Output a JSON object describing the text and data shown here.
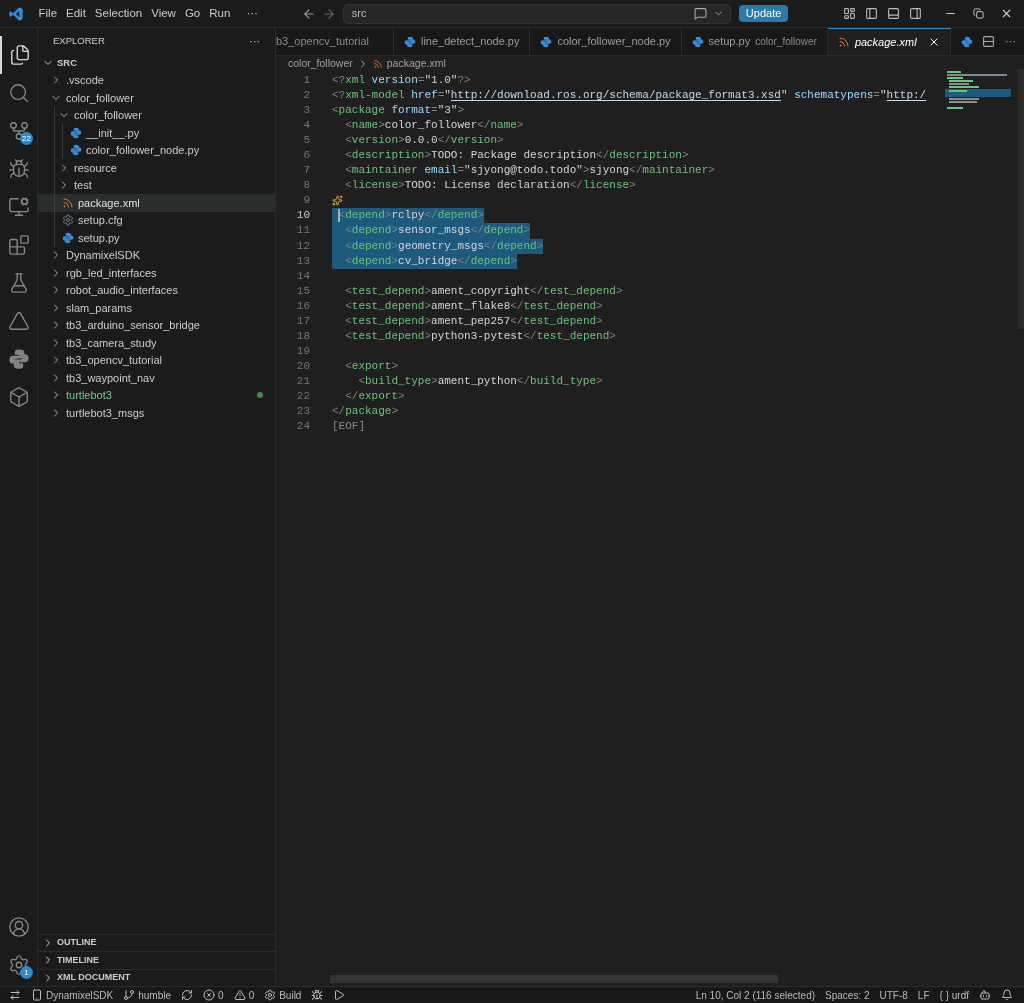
{
  "title_bar": {
    "menus": [
      "File",
      "Edit",
      "Selection",
      "View",
      "Go",
      "Run"
    ],
    "more": "···",
    "search": {
      "value": "src"
    },
    "update_button": "Update"
  },
  "activity_bar": {
    "top": [
      {
        "kind": "files",
        "selected": true
      },
      {
        "kind": "search",
        "selected": false
      },
      {
        "kind": "source-control",
        "selected": false,
        "badge": "22"
      },
      {
        "kind": "run",
        "selected": false
      },
      {
        "kind": "remote",
        "selected": false
      },
      {
        "kind": "extensions",
        "selected": false
      },
      {
        "kind": "testing",
        "selected": false
      },
      {
        "kind": "ros",
        "selected": false
      },
      {
        "kind": "python",
        "selected": false
      },
      {
        "kind": "container",
        "selected": false
      }
    ],
    "bottom": [
      {
        "kind": "account",
        "selected": false
      },
      {
        "kind": "settings",
        "selected": false,
        "badge": "1"
      }
    ]
  },
  "explorer": {
    "title": "EXPLORER",
    "more": "···",
    "root": "SRC",
    "items": [
      {
        "name": ".vscode",
        "kind": "folder",
        "expanded": false,
        "selected": false,
        "changed": false
      },
      {
        "name": "color_follower",
        "kind": "folder",
        "expanded": true,
        "selected": false,
        "changed": false,
        "children": [
          {
            "name": "color_follower",
            "kind": "folder",
            "expanded": true,
            "selected": false,
            "changed": false,
            "children": [
              {
                "name": "__init__.py",
                "kind": "python",
                "selected": false,
                "changed": false
              },
              {
                "name": "color_follower_node.py",
                "kind": "python",
                "selected": false,
                "changed": false
              }
            ]
          },
          {
            "name": "resource",
            "kind": "folder",
            "expanded": false,
            "selected": false,
            "changed": false
          },
          {
            "name": "test",
            "kind": "folder",
            "expanded": false,
            "selected": false,
            "changed": false
          },
          {
            "name": "package.xml",
            "kind": "xml",
            "selected": true,
            "changed": false
          },
          {
            "name": "setup.cfg",
            "kind": "config",
            "selected": false,
            "changed": false
          },
          {
            "name": "setup.py",
            "kind": "python",
            "selected": false,
            "changed": false
          }
        ]
      },
      {
        "name": "DynamixelSDK",
        "kind": "folder",
        "expanded": false,
        "selected": false,
        "changed": false
      },
      {
        "name": "rgb_led_interfaces",
        "kind": "folder",
        "expanded": false,
        "selected": false,
        "changed": false
      },
      {
        "name": "robot_audio_interfaces",
        "kind": "folder",
        "expanded": false,
        "selected": false,
        "changed": false
      },
      {
        "name": "slam_params",
        "kind": "folder",
        "expanded": false,
        "selected": false,
        "changed": false
      },
      {
        "name": "tb3_arduino_sensor_bridge",
        "kind": "folder",
        "expanded": false,
        "selected": false,
        "changed": false
      },
      {
        "name": "tb3_camera_study",
        "kind": "folder",
        "expanded": false,
        "selected": false,
        "changed": false
      },
      {
        "name": "tb3_opencv_tutorial",
        "kind": "folder",
        "expanded": false,
        "selected": false,
        "changed": false
      },
      {
        "name": "tb3_waypoint_nav",
        "kind": "folder",
        "expanded": false,
        "selected": false,
        "changed": false
      },
      {
        "name": "turtlebot3",
        "kind": "folder",
        "expanded": false,
        "selected": false,
        "changed": true
      },
      {
        "name": "turtlebot3_msgs",
        "kind": "folder",
        "expanded": false,
        "selected": false,
        "changed": false
      }
    ],
    "sections": [
      {
        "title": "OUTLINE",
        "expanded": false
      },
      {
        "title": "TIMELINE",
        "expanded": false
      },
      {
        "title": "XML DOCUMENT",
        "expanded": false
      }
    ]
  },
  "tabs": [
    {
      "label": "b3_opencv_tutorial",
      "kind": "none",
      "selected": false
    },
    {
      "label": "line_detect_node.py",
      "kind": "python",
      "selected": false
    },
    {
      "label": "color_follower_node.py",
      "kind": "python",
      "selected": false
    },
    {
      "label": "setup.py",
      "detail": "color_follower",
      "kind": "python",
      "selected": false
    },
    {
      "label": "package.xml",
      "kind": "xml",
      "selected": true
    },
    {
      "kind": "python",
      "selected": false
    }
  ],
  "tab_more": "···",
  "breadcrumb": [
    "color_follower",
    "package.xml"
  ],
  "editor": {
    "lines": [
      {
        "number": "1",
        "selected": false,
        "cursor": false,
        "sparkle": false,
        "tokens": [
          {
            "kind": "punct",
            "text": "<?"
          },
          {
            "kind": "tag",
            "text": "xml"
          },
          {
            "kind": "attr",
            "text": " version"
          },
          {
            "kind": "punct",
            "text": "="
          },
          {
            "kind": "string",
            "text": "\"1.0\""
          },
          {
            "kind": "punct",
            "text": "?>"
          }
        ]
      },
      {
        "number": "2",
        "selected": false,
        "cursor": false,
        "sparkle": false,
        "tokens": [
          {
            "kind": "punct",
            "text": "<?"
          },
          {
            "kind": "tag",
            "text": "xml-model"
          },
          {
            "kind": "attr",
            "text": " href"
          },
          {
            "kind": "punct",
            "text": "="
          },
          {
            "kind": "string",
            "text": "\""
          },
          {
            "kind": "link",
            "text": "http://download.ros.org/schema/package_format3.xsd"
          },
          {
            "kind": "string",
            "text": "\""
          },
          {
            "kind": "attr",
            "text": " schematypens"
          },
          {
            "kind": "punct",
            "text": "="
          },
          {
            "kind": "string",
            "text": "\""
          },
          {
            "kind": "link",
            "text": "http:/"
          }
        ]
      },
      {
        "number": "3",
        "selected": false,
        "cursor": false,
        "sparkle": false,
        "tokens": [
          {
            "kind": "punct",
            "text": "<"
          },
          {
            "kind": "tag",
            "text": "package"
          },
          {
            "kind": "attr",
            "text": " format"
          },
          {
            "kind": "punct",
            "text": "="
          },
          {
            "kind": "string",
            "text": "\"3\""
          },
          {
            "kind": "punct",
            "text": ">"
          }
        ]
      },
      {
        "number": "4",
        "selected": false,
        "cursor": false,
        "sparkle": false,
        "tokens": [
          {
            "kind": "punct",
            "text": "  <"
          },
          {
            "kind": "tag",
            "text": "name"
          },
          {
            "kind": "punct",
            "text": ">"
          },
          {
            "kind": "text",
            "text": "color_follower"
          },
          {
            "kind": "punct",
            "text": "</"
          },
          {
            "kind": "tag",
            "text": "name"
          },
          {
            "kind": "punct",
            "text": ">"
          }
        ]
      },
      {
        "number": "5",
        "selected": false,
        "cursor": false,
        "sparkle": false,
        "tokens": [
          {
            "kind": "punct",
            "text": "  <"
          },
          {
            "kind": "tag",
            "text": "version"
          },
          {
            "kind": "punct",
            "text": ">"
          },
          {
            "kind": "text",
            "text": "0.0.0"
          },
          {
            "kind": "punct",
            "text": "</"
          },
          {
            "kind": "tag",
            "text": "version"
          },
          {
            "kind": "punct",
            "text": ">"
          }
        ]
      },
      {
        "number": "6",
        "selected": false,
        "cursor": false,
        "sparkle": false,
        "tokens": [
          {
            "kind": "punct",
            "text": "  <"
          },
          {
            "kind": "tag",
            "text": "description"
          },
          {
            "kind": "punct",
            "text": ">"
          },
          {
            "kind": "text",
            "text": "TODO: Package description"
          },
          {
            "kind": "punct",
            "text": "</"
          },
          {
            "kind": "tag",
            "text": "description"
          },
          {
            "kind": "punct",
            "text": ">"
          }
        ]
      },
      {
        "number": "7",
        "selected": false,
        "cursor": false,
        "sparkle": false,
        "tokens": [
          {
            "kind": "punct",
            "text": "  <"
          },
          {
            "kind": "tag",
            "text": "maintainer"
          },
          {
            "kind": "attr",
            "text": " email"
          },
          {
            "kind": "punct",
            "text": "="
          },
          {
            "kind": "string",
            "text": "\"sjyong@todo.todo\""
          },
          {
            "kind": "punct",
            "text": ">"
          },
          {
            "kind": "text",
            "text": "sjyong"
          },
          {
            "kind": "punct",
            "text": "</"
          },
          {
            "kind": "tag",
            "text": "maintainer"
          },
          {
            "kind": "punct",
            "text": ">"
          }
        ]
      },
      {
        "number": "8",
        "selected": false,
        "cursor": false,
        "sparkle": false,
        "tokens": [
          {
            "kind": "punct",
            "text": "  <"
          },
          {
            "kind": "tag",
            "text": "license"
          },
          {
            "kind": "punct",
            "text": ">"
          },
          {
            "kind": "text",
            "text": "TODO: License declaration"
          },
          {
            "kind": "punct",
            "text": "</"
          },
          {
            "kind": "tag",
            "text": "license"
          },
          {
            "kind": "punct",
            "text": ">"
          }
        ]
      },
      {
        "number": "9",
        "selected": false,
        "cursor": false,
        "sparkle": true
      },
      {
        "number": "10",
        "selected": true,
        "cursor": true,
        "sparkle": false,
        "tokens": [
          {
            "kind": "punct",
            "text": " <"
          },
          {
            "kind": "tag",
            "text": "depend"
          },
          {
            "kind": "punct",
            "text": ">"
          },
          {
            "kind": "text",
            "text": "rclpy"
          },
          {
            "kind": "punct",
            "text": "</"
          },
          {
            "kind": "tag",
            "text": "depend"
          },
          {
            "kind": "punct",
            "text": ">"
          }
        ]
      },
      {
        "number": "11",
        "selected": true,
        "cursor": false,
        "sparkle": false,
        "tokens": [
          {
            "kind": "punct",
            "text": "  <"
          },
          {
            "kind": "tag",
            "text": "depend"
          },
          {
            "kind": "punct",
            "text": ">"
          },
          {
            "kind": "text",
            "text": "sensor_msgs"
          },
          {
            "kind": "punct",
            "text": "</"
          },
          {
            "kind": "tag",
            "text": "depend"
          },
          {
            "kind": "punct",
            "text": ">"
          }
        ]
      },
      {
        "number": "12",
        "selected": true,
        "cursor": false,
        "sparkle": false,
        "tokens": [
          {
            "kind": "punct",
            "text": "  <"
          },
          {
            "kind": "tag",
            "text": "depend"
          },
          {
            "kind": "punct",
            "text": ">"
          },
          {
            "kind": "text",
            "text": "geometry_msgs"
          },
          {
            "kind": "punct",
            "text": "</"
          },
          {
            "kind": "tag",
            "text": "depend"
          },
          {
            "kind": "punct",
            "text": ">"
          }
        ]
      },
      {
        "number": "13",
        "selected": true,
        "cursor": false,
        "sparkle": false,
        "tokens": [
          {
            "kind": "punct",
            "text": "  <"
          },
          {
            "kind": "tag",
            "text": "depend"
          },
          {
            "kind": "punct",
            "text": ">"
          },
          {
            "kind": "text",
            "text": "cv_bridge"
          },
          {
            "kind": "punct",
            "text": "</"
          },
          {
            "kind": "tag",
            "text": "depend"
          },
          {
            "kind": "punct",
            "text": ">"
          }
        ]
      },
      {
        "number": "14",
        "selected": false,
        "cursor": false,
        "sparkle": false
      },
      {
        "number": "15",
        "selected": false,
        "cursor": false,
        "sparkle": false,
        "tokens": [
          {
            "kind": "punct",
            "text": "  <"
          },
          {
            "kind": "tag",
            "text": "test_depend"
          },
          {
            "kind": "punct",
            "text": ">"
          },
          {
            "kind": "text",
            "text": "ament_copyright"
          },
          {
            "kind": "punct",
            "text": "</"
          },
          {
            "kind": "tag",
            "text": "test_depend"
          },
          {
            "kind": "punct",
            "text": ">"
          }
        ]
      },
      {
        "number": "16",
        "selected": false,
        "cursor": false,
        "sparkle": false,
        "tokens": [
          {
            "kind": "punct",
            "text": "  <"
          },
          {
            "kind": "tag",
            "text": "test_depend"
          },
          {
            "kind": "punct",
            "text": ">"
          },
          {
            "kind": "text",
            "text": "ament_flake8"
          },
          {
            "kind": "punct",
            "text": "</"
          },
          {
            "kind": "tag",
            "text": "test_depend"
          },
          {
            "kind": "punct",
            "text": ">"
          }
        ]
      },
      {
        "number": "17",
        "selected": false,
        "cursor": false,
        "sparkle": false,
        "tokens": [
          {
            "kind": "punct",
            "text": "  <"
          },
          {
            "kind": "tag",
            "text": "test_depend"
          },
          {
            "kind": "punct",
            "text": ">"
          },
          {
            "kind": "text",
            "text": "ament_pep257"
          },
          {
            "kind": "punct",
            "text": "</"
          },
          {
            "kind": "tag",
            "text": "test_depend"
          },
          {
            "kind": "punct",
            "text": ">"
          }
        ]
      },
      {
        "number": "18",
        "selected": false,
        "cursor": false,
        "sparkle": false,
        "tokens": [
          {
            "kind": "punct",
            "text": "  <"
          },
          {
            "kind": "tag",
            "text": "test_depend"
          },
          {
            "kind": "punct",
            "text": ">"
          },
          {
            "kind": "text",
            "text": "python3-pytest"
          },
          {
            "kind": "punct",
            "text": "</"
          },
          {
            "kind": "tag",
            "text": "test_depend"
          },
          {
            "kind": "punct",
            "text": ">"
          }
        ]
      },
      {
        "number": "19",
        "selected": false,
        "cursor": false,
        "sparkle": false
      },
      {
        "number": "20",
        "selected": false,
        "cursor": false,
        "sparkle": false,
        "tokens": [
          {
            "kind": "punct",
            "text": "  <"
          },
          {
            "kind": "tag",
            "text": "export"
          },
          {
            "kind": "punct",
            "text": ">"
          }
        ]
      },
      {
        "number": "21",
        "selected": false,
        "cursor": false,
        "sparkle": false,
        "tokens": [
          {
            "kind": "punct",
            "text": "    <"
          },
          {
            "kind": "tag",
            "text": "build_type"
          },
          {
            "kind": "punct",
            "text": ">"
          },
          {
            "kind": "text",
            "text": "ament_python"
          },
          {
            "kind": "punct",
            "text": "</"
          },
          {
            "kind": "tag",
            "text": "build_type"
          },
          {
            "kind": "punct",
            "text": ">"
          }
        ]
      },
      {
        "number": "22",
        "selected": false,
        "cursor": false,
        "sparkle": false,
        "tokens": [
          {
            "kind": "punct",
            "text": "  </"
          },
          {
            "kind": "tag",
            "text": "export"
          },
          {
            "kind": "punct",
            "text": ">"
          }
        ]
      },
      {
        "number": "23",
        "selected": false,
        "cursor": false,
        "sparkle": false,
        "tokens": [
          {
            "kind": "punct",
            "text": "</"
          },
          {
            "kind": "tag",
            "text": "package"
          },
          {
            "kind": "punct",
            "text": ">"
          }
        ]
      },
      {
        "number": "24",
        "selected": false,
        "cursor": false,
        "sparkle": false,
        "tokens": [
          {
            "kind": "eof",
            "text": "[EOF]"
          }
        ]
      }
    ]
  },
  "status_bar": {
    "left": [
      {
        "kind": "remote"
      },
      {
        "kind": "device",
        "text": "DynamixelSDK"
      },
      {
        "kind": "branch",
        "text": "humble"
      },
      {
        "kind": "sync"
      },
      {
        "kind": "errors",
        "text": "0"
      },
      {
        "kind": "warnings",
        "text": "0"
      },
      {
        "kind": "build",
        "text": "Build"
      },
      {
        "kind": "debug"
      },
      {
        "kind": "run"
      }
    ],
    "right": [
      {
        "kind": "text",
        "text": "Ln 10, Col 2 (116 selected)"
      },
      {
        "kind": "text",
        "text": "Spaces: 2"
      },
      {
        "kind": "text",
        "text": "UTF-8"
      },
      {
        "kind": "text",
        "text": "LF"
      },
      {
        "kind": "text",
        "text": "{ } urdf"
      },
      {
        "kind": "copilot"
      },
      {
        "kind": "bell"
      }
    ]
  }
}
